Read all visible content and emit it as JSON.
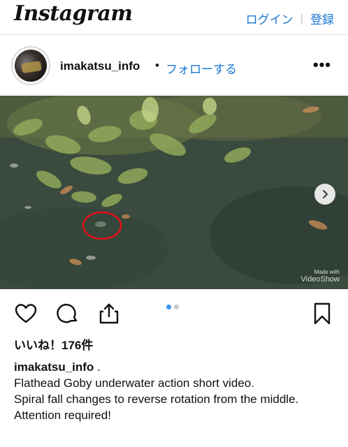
{
  "header": {
    "logo": "Instagram",
    "login_label": "ログイン",
    "separator": "|",
    "signup_label": "登録"
  },
  "post": {
    "username": "imakatsu_info",
    "dot": "•",
    "follow_label": "フォローする",
    "more_label": "•••",
    "media": {
      "next_icon": "chevron-right-icon",
      "watermark_top": "Made with",
      "watermark": "VideoShow",
      "carousel_count": 2,
      "carousel_active": 0
    },
    "likes": "いいね！176件",
    "caption": {
      "username": "imakatsu_info",
      "suffix": " .",
      "lines": [
        "Flathead Goby underwater action short video.",
        "Spiral fall changes to reverse rotation from the middle.",
        "Attention required!"
      ]
    }
  },
  "colors": {
    "accent": "#1877d2",
    "carousel_active": "#3897f0",
    "annotation_circle": "#e0101a"
  }
}
